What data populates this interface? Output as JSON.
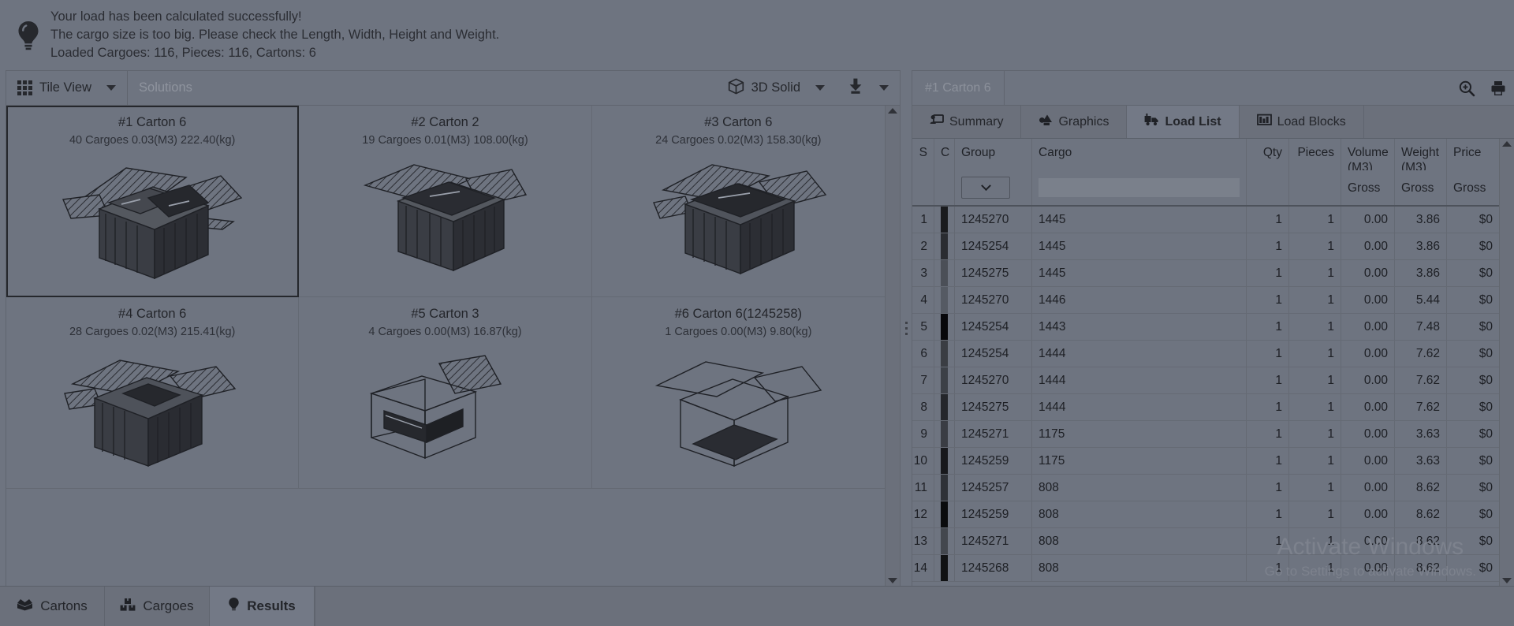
{
  "notice": {
    "icon": "lightbulb-icon",
    "lines": [
      "Your load has been calculated successfully!",
      "The cargo size is too big. Please check the Length, Width, Height and Weight.",
      "Loaded Cargoes: 116, Pieces: 116, Cartons: 6"
    ]
  },
  "toolbar": {
    "view_label": "Tile View",
    "solutions_label": "Solutions",
    "render_label": "3D Solid",
    "view_icon": "grid-icon",
    "render_icon": "cube-icon",
    "download_icon": "download-icon"
  },
  "tiles": [
    {
      "title": "#1 Carton 6",
      "sub": "40 Cargoes 0.03(M3) 222.40(kg)",
      "selected": true
    },
    {
      "title": "#2 Carton 2",
      "sub": "19 Cargoes 0.01(M3) 108.00(kg)",
      "selected": false
    },
    {
      "title": "#3 Carton 6",
      "sub": "24 Cargoes 0.02(M3) 158.30(kg)",
      "selected": false
    },
    {
      "title": "#4 Carton 6",
      "sub": "28 Cargoes 0.02(M3) 215.41(kg)",
      "selected": false
    },
    {
      "title": "#5 Carton 3",
      "sub": "4 Cargoes 0.00(M3) 16.87(kg)",
      "selected": false
    },
    {
      "title": "#6 Carton 6(1245258)",
      "sub": "1 Cargoes 0.00(M3) 9.80(kg)",
      "selected": false
    }
  ],
  "right_panel": {
    "title": "#1 Carton 6",
    "zoom_icon": "zoom-in-icon",
    "print_icon": "printer-icon",
    "tabs": [
      {
        "label": "Summary",
        "icon": "summary-icon",
        "active": false
      },
      {
        "label": "Graphics",
        "icon": "graphics-icon",
        "active": false
      },
      {
        "label": "Load List",
        "icon": "truck-icon",
        "active": true
      },
      {
        "label": "Load Blocks",
        "icon": "load-blocks-icon",
        "active": false
      }
    ],
    "table": {
      "headers": {
        "no": "S",
        "color": "C",
        "group": "Group",
        "cargo": "Cargo",
        "qty": "Qty",
        "pieces": "Pieces",
        "volume": "Volume (M3)",
        "weight": "Weight (M3)",
        "price": "Price"
      },
      "subheaders": {
        "volume": "Gross",
        "weight": "Gross",
        "price": "Gross"
      },
      "filters": {
        "group_value": "",
        "cargo_value": "",
        "cargo_placeholder": ""
      },
      "rows": [
        {
          "no": "1",
          "color": "#1a1b1e",
          "group": "1245270",
          "cargo": "1445",
          "qty": "1",
          "pieces": "1",
          "volume": "0.00",
          "weight": "3.86",
          "price": "$0"
        },
        {
          "no": "2",
          "color": "#2a2c31",
          "group": "1245254",
          "cargo": "1445",
          "qty": "1",
          "pieces": "1",
          "volume": "0.00",
          "weight": "3.86",
          "price": "$0"
        },
        {
          "no": "3",
          "color": "#4b4f57",
          "group": "1245275",
          "cargo": "1445",
          "qty": "1",
          "pieces": "1",
          "volume": "0.00",
          "weight": "3.86",
          "price": "$0"
        },
        {
          "no": "4",
          "color": "#555a63",
          "group": "1245270",
          "cargo": "1446",
          "qty": "1",
          "pieces": "1",
          "volume": "0.00",
          "weight": "5.44",
          "price": "$0"
        },
        {
          "no": "5",
          "color": "#07070a",
          "group": "1245254",
          "cargo": "1443",
          "qty": "1",
          "pieces": "1",
          "volume": "0.00",
          "weight": "7.48",
          "price": "$0"
        },
        {
          "no": "6",
          "color": "#3a3d43",
          "group": "1245254",
          "cargo": "1444",
          "qty": "1",
          "pieces": "1",
          "volume": "0.00",
          "weight": "7.62",
          "price": "$0"
        },
        {
          "no": "7",
          "color": "#3c4047",
          "group": "1245270",
          "cargo": "1444",
          "qty": "1",
          "pieces": "1",
          "volume": "0.00",
          "weight": "7.62",
          "price": "$0"
        },
        {
          "no": "8",
          "color": "#24262b",
          "group": "1245275",
          "cargo": "1444",
          "qty": "1",
          "pieces": "1",
          "volume": "0.00",
          "weight": "7.62",
          "price": "$0"
        },
        {
          "no": "9",
          "color": "#3a3d44",
          "group": "1245271",
          "cargo": "1175",
          "qty": "1",
          "pieces": "1",
          "volume": "0.00",
          "weight": "3.63",
          "price": "$0"
        },
        {
          "no": "10",
          "color": "#17181c",
          "group": "1245259",
          "cargo": "1175",
          "qty": "1",
          "pieces": "1",
          "volume": "0.00",
          "weight": "3.63",
          "price": "$0"
        },
        {
          "no": "11",
          "color": "#2e3137",
          "group": "1245257",
          "cargo": "808",
          "qty": "1",
          "pieces": "1",
          "volume": "0.00",
          "weight": "8.62",
          "price": "$0"
        },
        {
          "no": "12",
          "color": "#0a0b0d",
          "group": "1245259",
          "cargo": "808",
          "qty": "1",
          "pieces": "1",
          "volume": "0.00",
          "weight": "8.62",
          "price": "$0"
        },
        {
          "no": "13",
          "color": "#43474e",
          "group": "1245271",
          "cargo": "808",
          "qty": "1",
          "pieces": "1",
          "volume": "0.00",
          "weight": "8.62",
          "price": "$0"
        },
        {
          "no": "14",
          "color": "#111214",
          "group": "1245268",
          "cargo": "808",
          "qty": "1",
          "pieces": "1",
          "volume": "0.00",
          "weight": "8.62",
          "price": "$0"
        }
      ]
    }
  },
  "bottom_tabs": [
    {
      "label": "Cartons",
      "icon": "open-box-icon",
      "active": false
    },
    {
      "label": "Cargoes",
      "icon": "boxes-icon",
      "active": false
    },
    {
      "label": "Results",
      "icon": "lightbulb-icon",
      "active": true
    }
  ],
  "watermark": {
    "title": "Activate Windows",
    "subtitle": "Go to Settings to activate Windows."
  }
}
